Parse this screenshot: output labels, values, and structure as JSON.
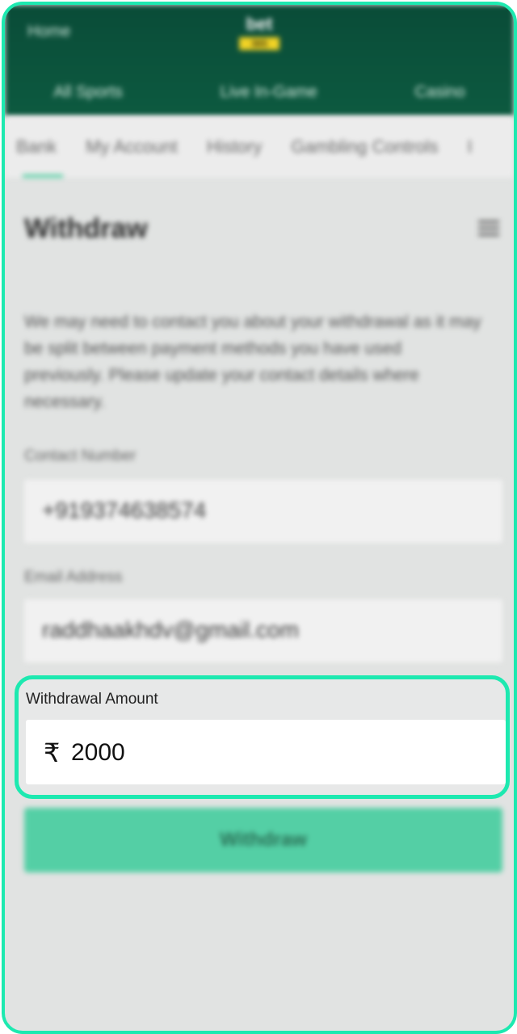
{
  "header": {
    "left_link": "Home",
    "logo_top": "bet",
    "logo_bottom": "365",
    "nav": [
      "All Sports",
      "Live In-Game",
      "Casino"
    ]
  },
  "tabs": [
    "Bank",
    "My Account",
    "History",
    "Gambling Controls",
    "I"
  ],
  "page": {
    "title": "Withdraw",
    "info": "We may need to contact you about your withdrawal as it may be split between payment methods you have used previously. Please update your contact details where necessary."
  },
  "form": {
    "contact_label": "Contact Number",
    "contact_value": "+919374638574",
    "email_label": "Email Address",
    "email_value": "raddhaakhdv@gmail.com",
    "amount_label": "Withdrawal Amount",
    "currency_symbol": "₹",
    "amount_value": "2000",
    "submit_label": "Withdraw"
  },
  "colors": {
    "highlight": "#1de9b0",
    "header": "#0a4c38",
    "button": "#54cfa5"
  }
}
